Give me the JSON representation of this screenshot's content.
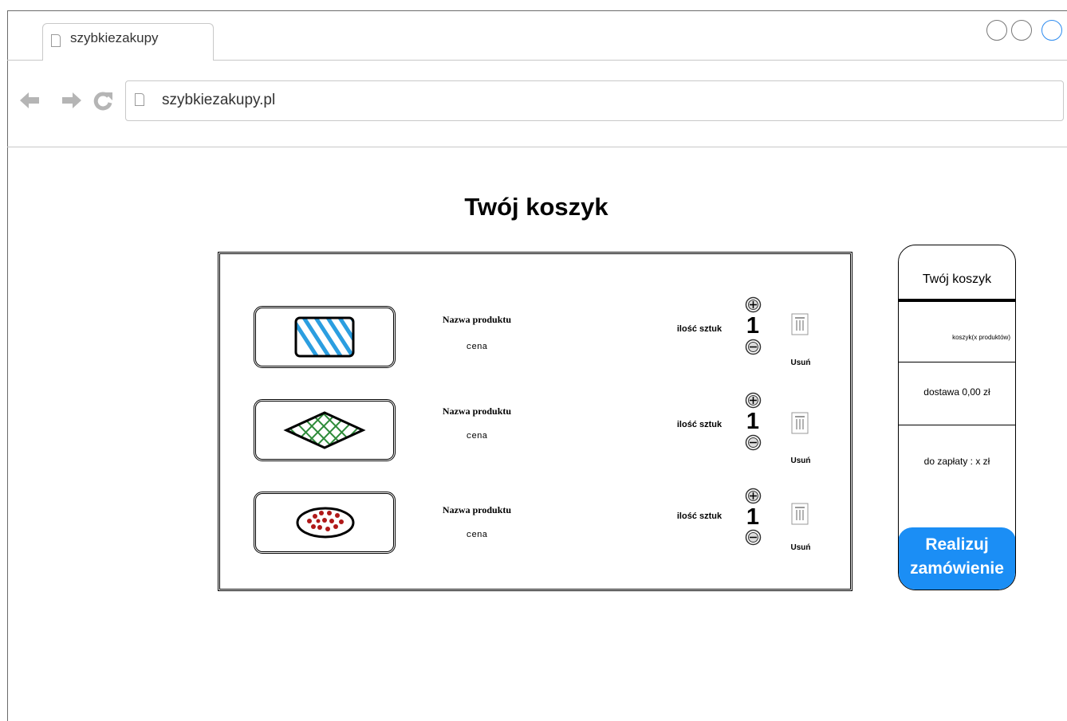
{
  "browser": {
    "tab_title": "szybkiezakupy",
    "url": "szybkiezakupy.pl"
  },
  "page": {
    "title": "Twój koszyk"
  },
  "cart": {
    "items": [
      {
        "name": "Nazwa produktu",
        "price": "cena",
        "qty_label": "ilość sztuk",
        "qty": "1",
        "remove_label": "Usuń",
        "thumb_color": "#2b9ee0"
      },
      {
        "name": "Nazwa produktu",
        "price": "cena",
        "qty_label": "ilość sztuk",
        "qty": "1",
        "remove_label": "Usuń",
        "thumb_color": "#2e8b3a"
      },
      {
        "name": "Nazwa produktu",
        "price": "cena",
        "qty_label": "ilość sztuk",
        "qty": "1",
        "remove_label": "Usuń",
        "thumb_color": "#b01818"
      }
    ]
  },
  "summary": {
    "title": "Twój koszyk",
    "items_count": "koszyk(x produktów)",
    "delivery": "dostawa 0,00 zł",
    "total": "do zapłaty : x zł",
    "order_button": {
      "line1": "Realizuj",
      "line2": "zamówienie",
      "color": "#1b8ef5"
    }
  }
}
